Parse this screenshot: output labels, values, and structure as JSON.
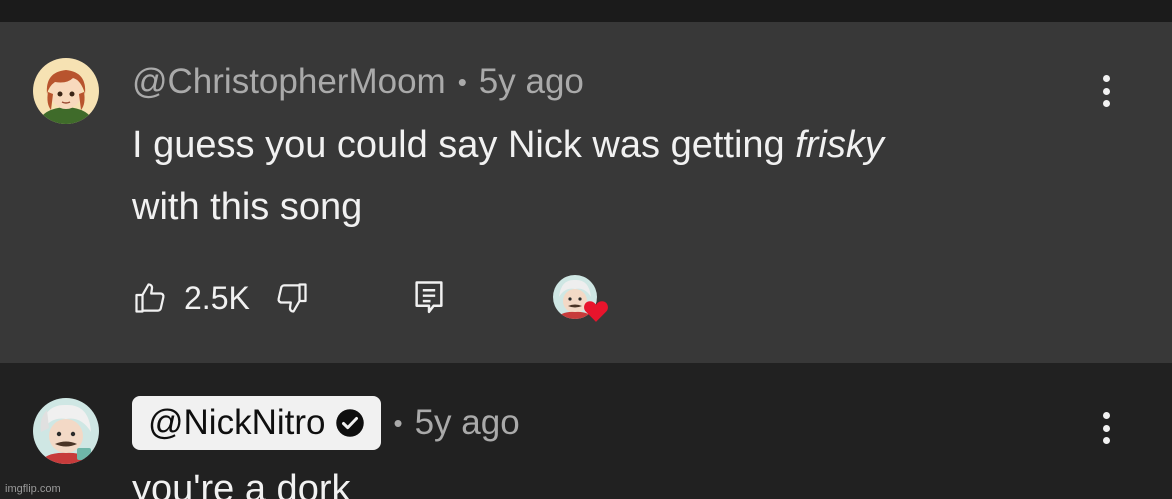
{
  "comments": [
    {
      "author": "@ChristopherMoom",
      "separator": "•",
      "time": "5y ago",
      "text_line1_plain": "I guess you could say Nick was getting ",
      "text_line1_italic": "frisky",
      "text_line2": "with this song",
      "likes": "2.5K",
      "hearted": true,
      "avatar": "avatar-icon",
      "menu_icon": "more-vert-icon"
    },
    {
      "author": "@NickNitro",
      "verified": true,
      "separator": "•",
      "time": "5y ago",
      "text": "you're a dork",
      "avatar": "avatar-icon",
      "menu_icon": "more-vert-icon"
    }
  ],
  "icons": {
    "like": "thumb-up-icon",
    "dislike": "thumb-down-icon",
    "reply": "reply-icon",
    "heart": "heart-icon",
    "verified": "verified-check-icon"
  },
  "colors": {
    "background": "#212121",
    "highlight_background": "#383838",
    "text_primary": "#f1f1f1",
    "text_secondary": "#aaaaaa",
    "heart": "#e8142c"
  },
  "watermark": "imgflip.com"
}
